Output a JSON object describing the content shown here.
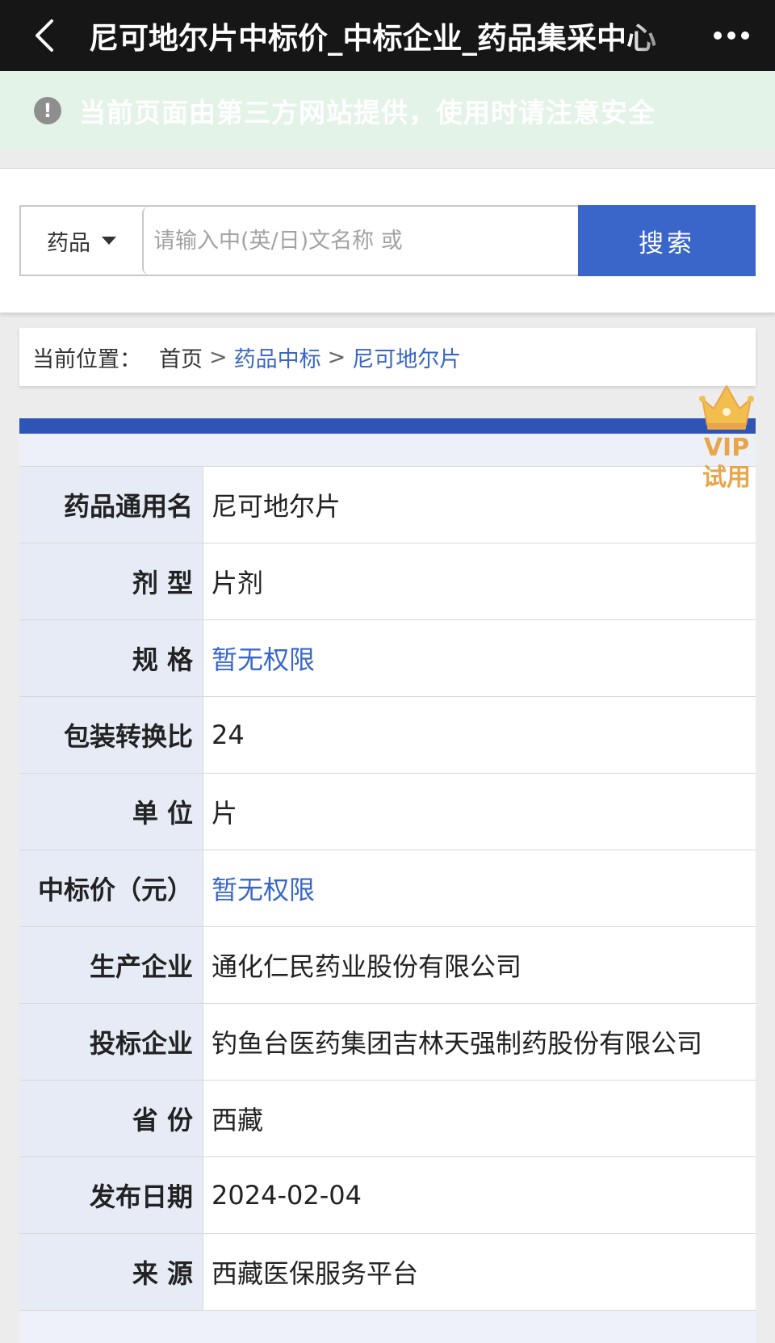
{
  "header": {
    "title": "尼可地尔片中标价_中标企业_药品集采中心",
    "back_icon": "chevron-left-icon",
    "more_icon": "more-dots-icon"
  },
  "notice": {
    "icon": "alert-circle-icon",
    "text": "当前页面由第三方网站提供，使用时请注意安全"
  },
  "search": {
    "category": "药品",
    "placeholder": "请输入中(英/日)文名称 或",
    "button_label": "搜索"
  },
  "breadcrumb": {
    "label": "当前位置：",
    "home": "首页",
    "separator": ">",
    "level1": "药品中标",
    "level2": "尼可地尔片"
  },
  "vip": {
    "icon": "crown-icon",
    "line1": "VIP",
    "line2": "试用"
  },
  "details": {
    "rows": [
      {
        "label": "药品通用名",
        "value": "尼可地尔片"
      },
      {
        "label": "剂 型",
        "value": "片剂"
      },
      {
        "label": "规 格",
        "value": "暂无权限"
      },
      {
        "label": "包装转换比",
        "value": "24"
      },
      {
        "label": "单 位",
        "value": "片"
      },
      {
        "label": "中标价（元）",
        "value": "暂无权限"
      },
      {
        "label": "生产企业",
        "value": "通化仁民药业股份有限公司"
      },
      {
        "label": "投标企业",
        "value": "钓鱼台医药集团吉林天强制药股份有限公司"
      },
      {
        "label": "省 份",
        "value": "西藏"
      },
      {
        "label": "发布日期",
        "value": "2024-02-04"
      },
      {
        "label": "来 源",
        "value": "西藏医保服务平台"
      }
    ]
  },
  "colors": {
    "top_bar": "#161616",
    "notice_bg": "#e3f3e8",
    "accent_blue": "#3966c8",
    "table_accent": "#2f55b4",
    "label_bg": "#e6ebf6",
    "vip_gold": "#e8a54a"
  }
}
